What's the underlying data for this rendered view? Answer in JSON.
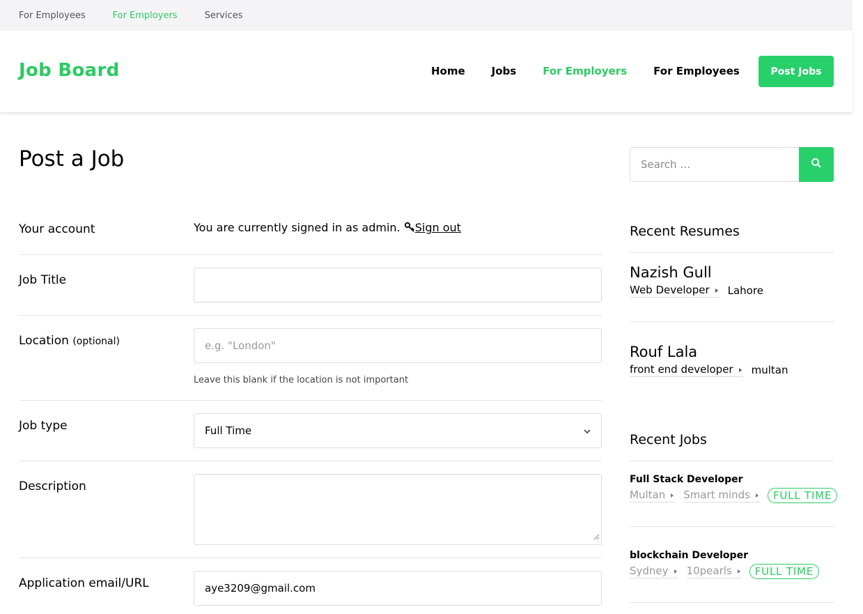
{
  "topbar": {
    "links": [
      "For Employees",
      "For Employers",
      "Services"
    ]
  },
  "header": {
    "logo": "Job Board",
    "nav": [
      "Home",
      "Jobs",
      "For Employers",
      "For Employees"
    ],
    "post_button": "Post Jobs"
  },
  "page": {
    "title": "Post a Job"
  },
  "form": {
    "account_label": "Your account",
    "account_text": "You are currently signed in as admin.",
    "signout_label": "Sign out",
    "job_title_label": "Job Title",
    "job_title_value": "",
    "location_label": "Location",
    "location_optional": "(optional)",
    "location_placeholder": "e.g. \"London\"",
    "location_hint": "Leave this blank if the location is not important",
    "job_type_label": "Job type",
    "job_type_value": "Full Time",
    "description_label": "Description",
    "description_value": "",
    "email_label": "Application email/URL",
    "email_value": "aye3209@gmail.com"
  },
  "sidebar": {
    "search_placeholder": "Search …",
    "recent_resumes_title": "Recent Resumes",
    "resumes": [
      {
        "name": "Nazish Gull",
        "role": "Web Developer",
        "location": "Lahore"
      },
      {
        "name": "Rouf Lala",
        "role": "front end developer",
        "location": "multan"
      }
    ],
    "recent_jobs_title": "Recent Jobs",
    "jobs": [
      {
        "title": "Full Stack Developer",
        "location": "Multan",
        "company": "Smart minds",
        "type": "FULL TIME"
      },
      {
        "title": "blockchain Developer",
        "location": "Sydney",
        "company": "10pearls",
        "type": "FULL TIME"
      }
    ]
  },
  "colors": {
    "accent": "#2bca63",
    "button": "#28d06a"
  }
}
